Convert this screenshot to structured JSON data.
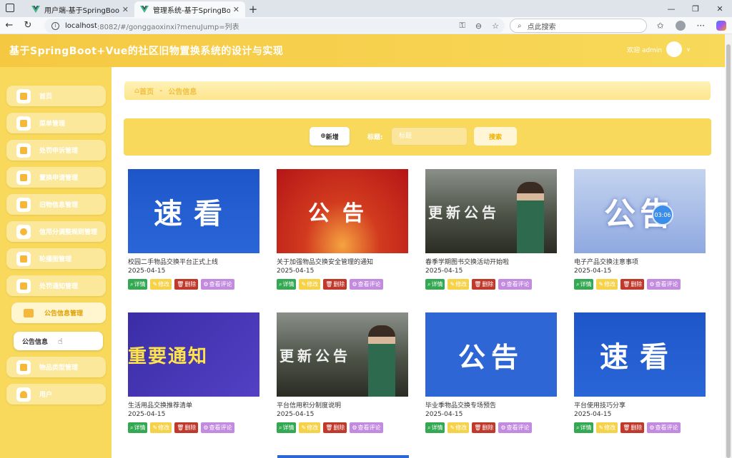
{
  "browser": {
    "tabs": [
      {
        "title": "用户端-基于SpringBoot+Vue的社",
        "active": false
      },
      {
        "title": "管理系统-基于SpringBoot+Vue的",
        "active": true
      }
    ],
    "url_host": "localhost",
    "url_path": ":8082/#/gonggaoxinxi?menuJump=列表",
    "search_placeholder": "点此搜索"
  },
  "header": {
    "title": "基于SpringBoot+Vue的社区旧物置换系统的设计与实现",
    "welcome": "欢迎 admin"
  },
  "sidebar": {
    "items": [
      {
        "label": "首页"
      },
      {
        "label": "菜单管理"
      },
      {
        "label": "处罚申诉管理"
      },
      {
        "label": "置换申请管理"
      },
      {
        "label": "旧物信息管理"
      },
      {
        "label": "信用分调整规则管理"
      },
      {
        "label": "轮播图管理"
      },
      {
        "label": "处罚通知管理"
      },
      {
        "label": "公告信息管理"
      },
      {
        "label": "物品类型管理"
      },
      {
        "label": "用户"
      }
    ],
    "submenu_label": "公告信息"
  },
  "breadcrumb": {
    "home": "首页",
    "separator": "-",
    "current": "公告信息"
  },
  "toolbar": {
    "add_label": "新增",
    "title_label": "标题:",
    "title_placeholder": "标题",
    "search_label": "搜索"
  },
  "actions": {
    "detail": "详情",
    "edit": "修改",
    "delete": "删除",
    "comment": "查看评论"
  },
  "cards": [
    {
      "title": "校园二手物品交换平台正式上线",
      "date": "2025-04-15",
      "thumb_text": "速看",
      "thumb_style": "blue"
    },
    {
      "title": "关于加强物品交换安全管理的通知",
      "date": "2025-04-15",
      "thumb_text": "公告",
      "thumb_style": "red"
    },
    {
      "title": "春季学期图书交换活动开始啦",
      "date": "2025-04-15",
      "thumb_text": "更新公告",
      "thumb_style": "game"
    },
    {
      "title": "电子产品交换注意事项",
      "date": "2025-04-15",
      "thumb_text": "公告",
      "thumb_style": "pale"
    },
    {
      "title": "生活用品交换推荐清单",
      "date": "2025-04-15",
      "thumb_text": "重要通知",
      "thumb_style": "purple"
    },
    {
      "title": "平台信用积分制度说明",
      "date": "2025-04-15",
      "thumb_text": "更新公告",
      "thumb_style": "game"
    },
    {
      "title": "毕业季物品交换专场预告",
      "date": "2025-04-15",
      "thumb_text": "公告",
      "thumb_style": "flat"
    },
    {
      "title": "平台使用技巧分享",
      "date": "2025-04-15",
      "thumb_text": "速看",
      "thumb_style": "blue"
    }
  ],
  "timer": "03:06",
  "colors": {
    "accent": "#f8d95c",
    "header": "#f5c842",
    "detail": "#34a853",
    "edit": "#f5d24a",
    "delete": "#c0392b",
    "comment": "#c38be0"
  }
}
